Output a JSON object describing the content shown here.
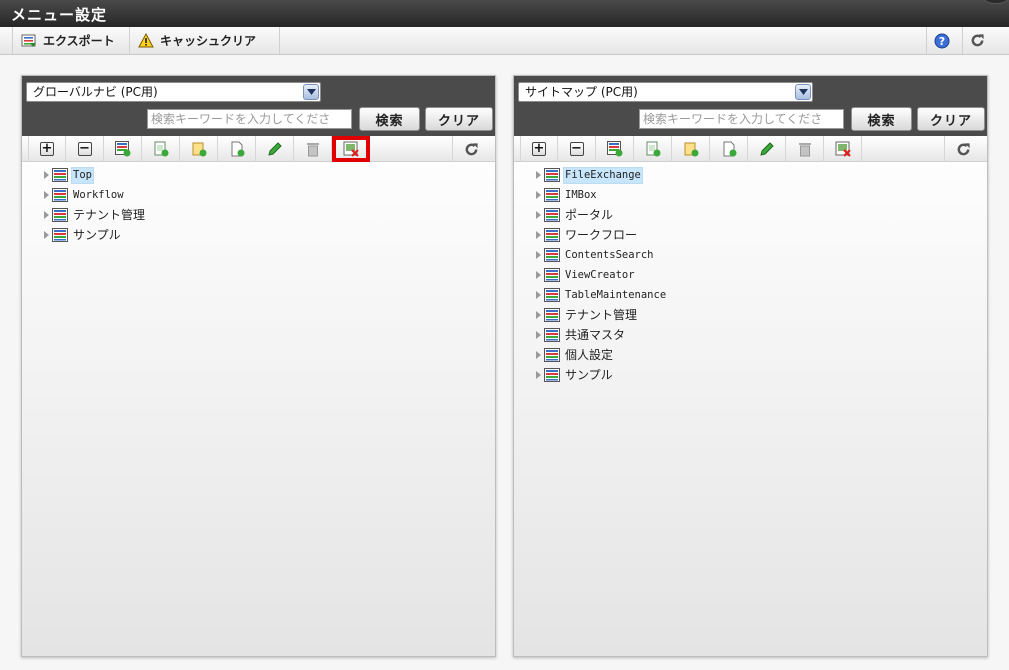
{
  "title": "メニュー設定",
  "toolbar": {
    "export_label": "エクスポート",
    "cache_clear_label": "キャッシュクリア"
  },
  "left_panel": {
    "select_value": "グローバルナビ (PC用)",
    "search_placeholder": "検索キーワードを入力してくださ",
    "search_label": "検索",
    "clear_label": "クリア",
    "tree": [
      {
        "label": "Top",
        "selected": true
      },
      {
        "label": "Workflow",
        "selected": false
      },
      {
        "label": "テナント管理",
        "selected": false
      },
      {
        "label": "サンプル",
        "selected": false
      }
    ]
  },
  "right_panel": {
    "select_value": "サイトマップ (PC用)",
    "search_placeholder": "検索キーワードを入力してくださ",
    "search_label": "検索",
    "clear_label": "クリア",
    "tree": [
      {
        "label": "FileExchange",
        "selected": true
      },
      {
        "label": "IMBox",
        "selected": false
      },
      {
        "label": "ポータル",
        "selected": false
      },
      {
        "label": "ワークフロー",
        "selected": false
      },
      {
        "label": "ContentsSearch",
        "selected": false
      },
      {
        "label": "ViewCreator",
        "selected": false
      },
      {
        "label": "TableMaintenance",
        "selected": false
      },
      {
        "label": "テナント管理",
        "selected": false
      },
      {
        "label": "共通マスタ",
        "selected": false
      },
      {
        "label": "個人設定",
        "selected": false
      },
      {
        "label": "サンプル",
        "selected": false
      }
    ]
  },
  "colors": {
    "title_bar": "#2e2e2e",
    "panel_header": "#4b4b4b",
    "selection": "#c8e6fb",
    "highlight": "#e00000"
  }
}
